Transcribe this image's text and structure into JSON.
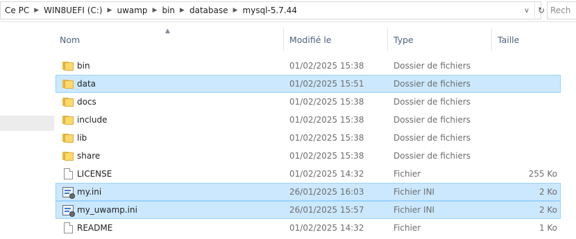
{
  "address": {
    "crumbs": [
      "Ce PC",
      "WIN8UEFI (C:)",
      "uwamp",
      "bin",
      "database",
      "mysql-5.7.44"
    ],
    "dropdown_glyph": "v",
    "refresh_glyph": "↻",
    "search_placeholder": "Rech"
  },
  "columns": {
    "name": "Nom",
    "date": "Modifié le",
    "type": "Type",
    "size": "Taille"
  },
  "rows": [
    {
      "name": "bin",
      "date": "01/02/2025 15:38",
      "type": "Dossier de fichiers",
      "size": "",
      "icon": "folder-icon",
      "selected": false
    },
    {
      "name": "data",
      "date": "01/02/2025 15:51",
      "type": "Dossier de fichiers",
      "size": "",
      "icon": "folder-icon",
      "selected": true
    },
    {
      "name": "docs",
      "date": "01/02/2025 15:38",
      "type": "Dossier de fichiers",
      "size": "",
      "icon": "folder-icon",
      "selected": false
    },
    {
      "name": "include",
      "date": "01/02/2025 15:38",
      "type": "Dossier de fichiers",
      "size": "",
      "icon": "folder-icon",
      "selected": false
    },
    {
      "name": "lib",
      "date": "01/02/2025 15:38",
      "type": "Dossier de fichiers",
      "size": "",
      "icon": "folder-icon",
      "selected": false
    },
    {
      "name": "share",
      "date": "01/02/2025 15:38",
      "type": "Dossier de fichiers",
      "size": "",
      "icon": "folder-icon",
      "selected": false
    },
    {
      "name": "LICENSE",
      "date": "01/02/2025 14:32",
      "type": "Fichier",
      "size": "255 Ko",
      "icon": "file-icon",
      "selected": false
    },
    {
      "name": "my.ini",
      "date": "26/01/2025 16:03",
      "type": "Fichier INI",
      "size": "2 Ko",
      "icon": "ini-file-icon",
      "selected": true
    },
    {
      "name": "my_uwamp.ini",
      "date": "26/01/2025 15:57",
      "type": "Fichier INI",
      "size": "2 Ko",
      "icon": "ini-file-icon",
      "selected": true
    },
    {
      "name": "README",
      "date": "01/02/2025 14:32",
      "type": "Fichier",
      "size": "1 Ko",
      "icon": "file-icon",
      "selected": false
    }
  ],
  "colors": {
    "selection_bg": "#cce8ff",
    "selection_border": "#99d1ff",
    "header_text": "#4c607a",
    "folder": "#ffd96a"
  }
}
